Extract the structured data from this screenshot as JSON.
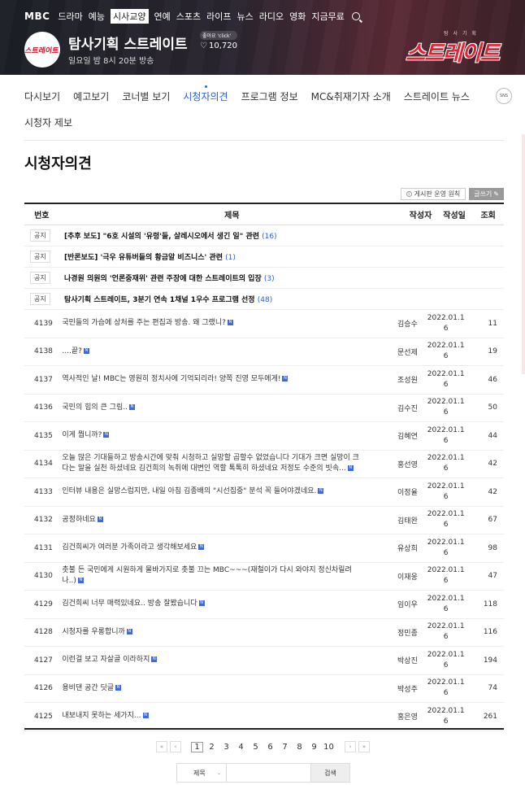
{
  "gnb": {
    "logo": "MBC",
    "items": [
      "드라마",
      "예능",
      "시사교양",
      "연예",
      "스포츠",
      "라이프",
      "뉴스",
      "라디오",
      "영화",
      "지금무료"
    ],
    "active_index": 2
  },
  "program": {
    "logo_text": "스트레이트",
    "title": "탐사기획 스트레이트",
    "time": "일요일 밤 8시 20분 방송",
    "like_tag": "좋아요 'click'",
    "like_count": "10,720",
    "big_logo_sub": "탐 사 기 획",
    "big_logo_main": "스트레이트"
  },
  "subnav": {
    "items": [
      "다시보기",
      "예고보기",
      "코너별 보기",
      "시청자의견",
      "프로그램 정보",
      "MC&취재기자 소개",
      "스트레이트 뉴스"
    ],
    "active_index": 3,
    "row2": "시청자 제보",
    "sns": "SNS"
  },
  "page_title": "시청자의견",
  "tools": {
    "rule_label": "게시판 운영 원칙",
    "write_label": "글쓰기"
  },
  "table": {
    "headers": {
      "no": "번호",
      "title": "제목",
      "writer": "작성자",
      "date": "작성일",
      "views": "조회"
    },
    "notice_label": "공지",
    "notices": [
      {
        "title": "[추후 보도] \"6호 시설의 '유령'들, 살레시오에서 생긴 일\" 관련",
        "count": "(16)"
      },
      {
        "title": "[반론보도] '극우 유튜버들의 황금알 비즈니스' 관련",
        "count": "(1)"
      },
      {
        "title": "나경원 의원의 '언론중재위' 관련 주장에 대한 스트레이트의 입장",
        "count": "(3)"
      },
      {
        "title": "탐사기획 스트레이트, 3분기 연속 1채널 1우수 프로그램 선정",
        "count": "(48)"
      }
    ],
    "rows": [
      {
        "no": "4139",
        "title": "국민들의 가슴에 상처를 주는 편집과 방송. 왜 그랬니?",
        "writer": "김승수",
        "date1": "2022.01.1",
        "date2": "6",
        "views": "11"
      },
      {
        "no": "4138",
        "title": "....끝?",
        "writer": "문선제",
        "date1": "2022.01.1",
        "date2": "6",
        "views": "19"
      },
      {
        "no": "4137",
        "title": "역사적인 날! MBC는 영원히 정치사에 기억되리라! 양쪽 진영 모두에게!",
        "writer": "조성원",
        "date1": "2022.01.1",
        "date2": "6",
        "views": "46"
      },
      {
        "no": "4136",
        "title": "국민의 힘의 큰 그림..",
        "writer": "김수진",
        "date1": "2022.01.1",
        "date2": "6",
        "views": "50"
      },
      {
        "no": "4135",
        "title": "이게 뭡니까?",
        "writer": "김혜연",
        "date1": "2022.01.1",
        "date2": "6",
        "views": "44"
      },
      {
        "no": "4134",
        "title": "오늘 많은 기대들하고 방송시간에 맞춰 시청하고 실망할 곱할수 없었습니다 기대가 크면 실망이 크다는 말을 실천 하셨네요 김건희의 녹취에 대변인 역할 톡톡히 하셨네요 저정도 수준의 빗속...",
        "writer": "홍선영",
        "date1": "2022.01.1",
        "date2": "6",
        "views": "42"
      },
      {
        "no": "4133",
        "title": "인터뷰 내용은 실망스럽지만, 내일 아침 김종배의 \"시선집중\" 분석 꼭 들어야겠네요.",
        "writer": "이정율",
        "date1": "2022.01.1",
        "date2": "6",
        "views": "42"
      },
      {
        "no": "4132",
        "title": "공정하네요",
        "writer": "김태완",
        "date1": "2022.01.1",
        "date2": "6",
        "views": "67"
      },
      {
        "no": "4131",
        "title": "김건희씨가 여러분 가족이라고 생각해보세요",
        "writer": "유상희",
        "date1": "2022.01.1",
        "date2": "6",
        "views": "98"
      },
      {
        "no": "4130",
        "title": "촛불 든 국민에게 시원하게 물바가지로 촛불 끄는 MBC~~~(재철이가 다시 와야지 정신차릴려나..)",
        "writer": "이재웅",
        "date1": "2022.01.1",
        "date2": "6",
        "views": "47"
      },
      {
        "no": "4129",
        "title": "김건희씨 너무 매력있네요.. 방송 잘봤습니다",
        "writer": "임이우",
        "date1": "2022.01.1",
        "date2": "6",
        "views": "118"
      },
      {
        "no": "4128",
        "title": "시청자를 우롱합니까",
        "writer": "정민종",
        "date1": "2022.01.1",
        "date2": "6",
        "views": "116"
      },
      {
        "no": "4127",
        "title": "이런걸 보고 자살골 이라하지",
        "writer": "박상진",
        "date1": "2022.01.1",
        "date2": "6",
        "views": "194"
      },
      {
        "no": "4126",
        "title": "용비댄 공간 딧글",
        "writer": "박성주",
        "date1": "2022.01.1",
        "date2": "6",
        "views": "74"
      },
      {
        "no": "4125",
        "title": "내보내지 못하는 세가지...",
        "writer": "홍은영",
        "date1": "2022.01.1",
        "date2": "6",
        "views": "261"
      }
    ]
  },
  "paging": {
    "first": "«",
    "prev": "‹",
    "next": "›",
    "last": "»",
    "pages": [
      "1",
      "2",
      "3",
      "4",
      "5",
      "6",
      "7",
      "8",
      "9",
      "10"
    ],
    "current": "1"
  },
  "search": {
    "select_value": "제목",
    "button": "검색"
  }
}
